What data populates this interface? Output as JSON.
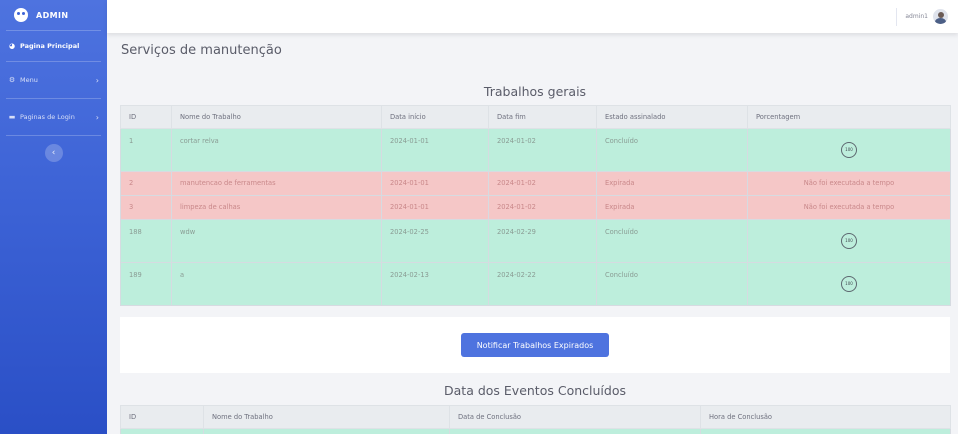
{
  "brand": {
    "name": "ADMIN"
  },
  "sidebar": {
    "items": [
      {
        "label": "Pagina Principal"
      },
      {
        "label": "Menu"
      },
      {
        "label": "Paginas de Login"
      }
    ],
    "toggle_glyph": "‹"
  },
  "topbar": {
    "user": "admin1"
  },
  "page": {
    "title": "Serviços de manutenção"
  },
  "general": {
    "title": "Trabalhos gerais",
    "headers": [
      "ID",
      "Nome do Trabalho",
      "Data início",
      "Data fim",
      "Estado assinalado",
      "Porcentagem"
    ],
    "rows": [
      {
        "id": "1",
        "name": "cortar relva",
        "start": "2024-01-01",
        "end": "2024-01-02",
        "status": "Concluído",
        "percent": "100",
        "state": "ok"
      },
      {
        "id": "2",
        "name": "manutencao de ferramentas",
        "start": "2024-01-01",
        "end": "2024-01-02",
        "status": "Expirada",
        "percent": "Não foi executada a tempo",
        "state": "exp"
      },
      {
        "id": "3",
        "name": "limpeza de calhas",
        "start": "2024-01-01",
        "end": "2024-01-02",
        "status": "Expirada",
        "percent": "Não foi executada a tempo",
        "state": "exp"
      },
      {
        "id": "188",
        "name": "wdw",
        "start": "2024-02-25",
        "end": "2024-02-29",
        "status": "Concluído",
        "percent": "100",
        "state": "ok"
      },
      {
        "id": "189",
        "name": "a",
        "start": "2024-02-13",
        "end": "2024-02-22",
        "status": "Concluído",
        "percent": "100",
        "state": "ok"
      }
    ]
  },
  "notify": {
    "label": "Notificar Trabalhos Expirados"
  },
  "completed": {
    "title": "Data dos Eventos Concluídos",
    "headers": [
      "ID",
      "Nome do Trabalho",
      "Data de Conclusão",
      "Hora de Conclusão"
    ]
  },
  "colors": {
    "primary": "#4e73df",
    "success_row": "#bdeedc",
    "expired_row": "#f5c7c7"
  }
}
